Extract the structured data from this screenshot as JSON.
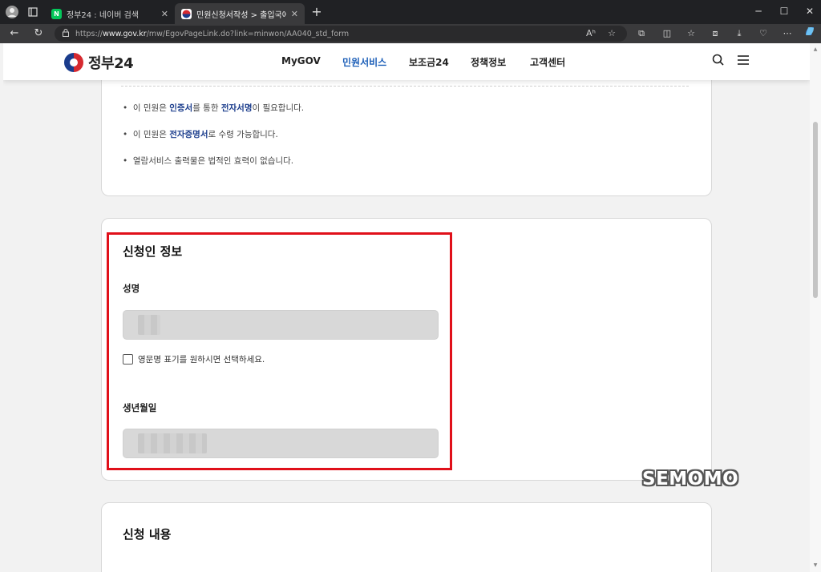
{
  "browser": {
    "tabs": [
      {
        "title": "정부24 : 네이버 검색",
        "favicon": "N",
        "active": false
      },
      {
        "title": "민원신청서작성 > 출입국에 관한",
        "favicon": "gov",
        "active": true
      }
    ],
    "url_prefix": "https://",
    "url_host": "www.gov.kr",
    "url_path": "/mw/EgovPageLink.do?link=minwon/AA040_std_form",
    "read_aloud": "Aʰ"
  },
  "header": {
    "logo_text": "정부24",
    "nav": [
      "MyGOV",
      "민원서비스",
      "보조금24",
      "정책정보",
      "고객센터"
    ],
    "active_nav": "민원서비스"
  },
  "notices": {
    "n1_pre": "이 민원은 ",
    "n1_hl1": "인증서",
    "n1_mid": "를 통한 ",
    "n1_hl2": "전자서명",
    "n1_post": "이 필요합니다.",
    "n2_pre": "이 민원은 ",
    "n2_hl": "전자증명서",
    "n2_post": "로 수령 가능합니다.",
    "n3": "열람서비스 출력물은 법적인 효력이 없습니다."
  },
  "applicant": {
    "section_title": "신청인 정보",
    "name_label": "성명",
    "english_name_checkbox": "영문명 표기를 원하시면 선택하세요.",
    "english_name_checked": false,
    "birth_label": "생년월일"
  },
  "request": {
    "section_title": "신청 내용"
  },
  "watermark": "SEMOMO",
  "colors": {
    "accent": "#1d5fb8",
    "highlight_box": "#e0101a",
    "notice_highlight": "#1a3c8c"
  }
}
